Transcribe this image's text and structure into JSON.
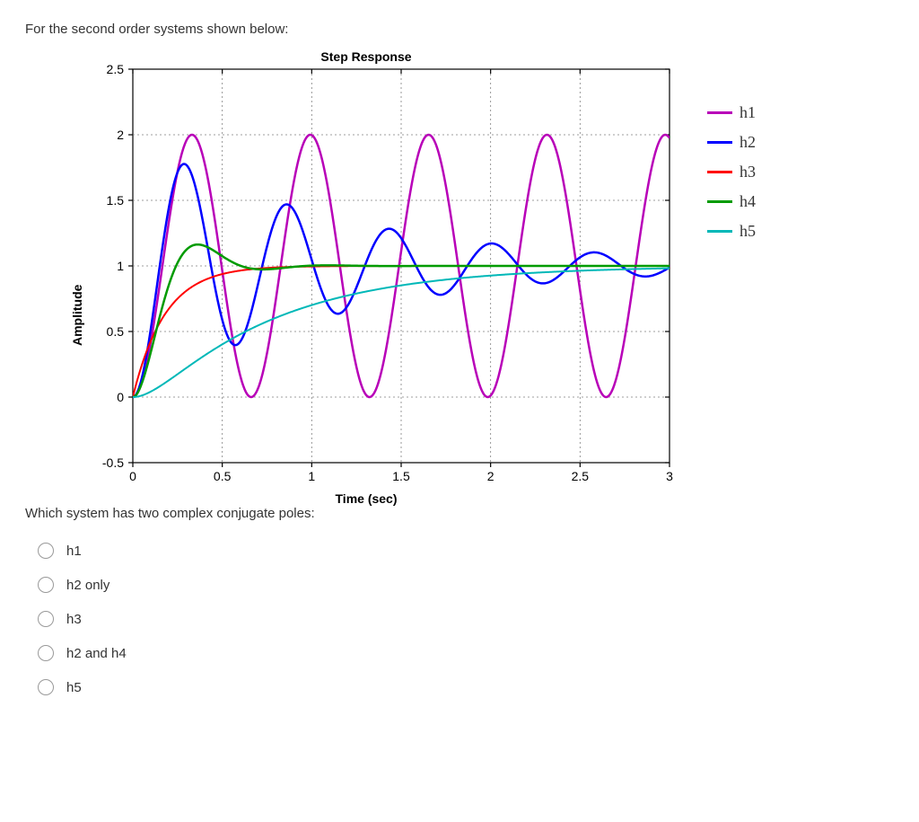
{
  "question_intro": "For the second order systems shown below:",
  "question_text": "Which system has two complex conjugate poles:",
  "options": [
    {
      "id": "opt-h1",
      "label": "h1"
    },
    {
      "id": "opt-h2only",
      "label": "h2 only"
    },
    {
      "id": "opt-h3",
      "label": "h3"
    },
    {
      "id": "opt-h2h4",
      "label": "h2 and h4"
    },
    {
      "id": "opt-h5",
      "label": "h5"
    }
  ],
  "chart_data": {
    "type": "line",
    "title": "Step Response",
    "xlabel": "Time (sec)",
    "ylabel": "Amplitude",
    "xlim": [
      0,
      3
    ],
    "ylim": [
      -0.5,
      2.5
    ],
    "xticks": [
      0,
      0.5,
      1,
      1.5,
      2,
      2.5,
      3
    ],
    "yticks": [
      -0.5,
      0,
      0.5,
      1,
      1.5,
      2,
      2.5
    ],
    "xgrid": [
      0.5,
      1,
      1.5,
      2,
      2.5
    ],
    "ygrid": [
      0,
      0.5,
      1.0,
      1.5,
      2.0
    ],
    "legend": [
      {
        "name": "h1",
        "color": "#b800b8"
      },
      {
        "name": "h2",
        "color": "#0000ff"
      },
      {
        "name": "h3",
        "color": "#ff0000"
      },
      {
        "name": "h4",
        "color": "#009b00"
      },
      {
        "name": "h5",
        "color": "#00b8b8"
      }
    ],
    "series": [
      {
        "name": "h1",
        "color": "#b800b8",
        "width": 2.5,
        "params": {
          "type": "undamped",
          "wd": 9.5,
          "amp": 1.0,
          "final": 1.0
        }
      },
      {
        "name": "h2",
        "color": "#0000ff",
        "width": 2.5,
        "params": {
          "type": "underdamped",
          "wn": 11,
          "zeta": 0.08,
          "final": 1.0
        }
      },
      {
        "name": "h3",
        "color": "#ff0000",
        "width": 2,
        "params": {
          "type": "firstorder",
          "tau": 0.18,
          "final": 1.0
        }
      },
      {
        "name": "h4",
        "color": "#009b00",
        "width": 2.5,
        "params": {
          "type": "underdamped",
          "wn": 10,
          "zeta": 0.5,
          "final": 1.0
        }
      },
      {
        "name": "h5",
        "color": "#00b8b8",
        "width": 2,
        "params": {
          "type": "overdamped",
          "p1": 1.4,
          "p2": 8.0,
          "final": 1.0
        }
      }
    ]
  }
}
